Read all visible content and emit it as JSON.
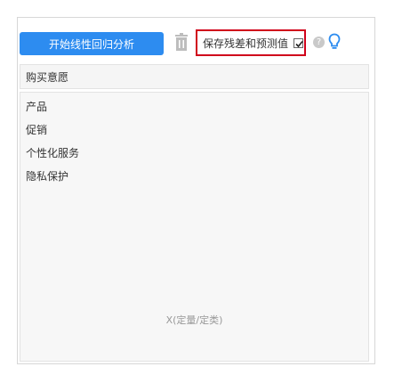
{
  "toolbar": {
    "run_label": "开始线性回归分析",
    "save_label": "保存残差和预测值",
    "save_checked": true,
    "help_glyph": "?"
  },
  "y_field": {
    "label": "购买意愿"
  },
  "x_field": {
    "items": [
      "产品",
      "促销",
      "个性化服务",
      "隐私保护"
    ],
    "caption": "X(定量/定类)"
  },
  "colors": {
    "primary": "#2d8cf0",
    "highlight_border": "#d0021b",
    "bulb": "#2d8cf0"
  }
}
